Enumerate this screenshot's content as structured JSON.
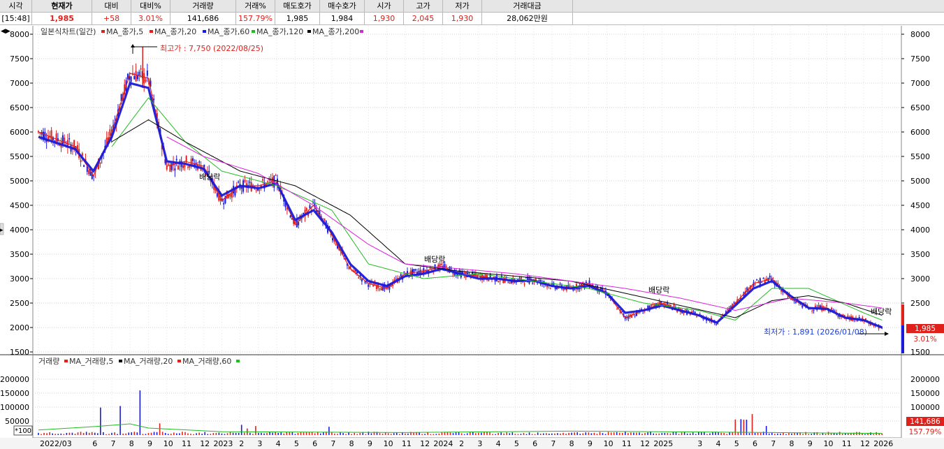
{
  "quote": {
    "headers": [
      "시각",
      "현재가",
      "대비",
      "대비%",
      "거래량",
      "거래%",
      "매도호가",
      "매수호가",
      "시가",
      "고가",
      "저가",
      "거래대금"
    ],
    "values": [
      "[15:48]",
      "1,985",
      "+58",
      "3.01%",
      "141,686",
      "157.79%",
      "1,985",
      "1,984",
      "1,930",
      "2,045",
      "1,930",
      "28,062만원"
    ]
  },
  "price_legend": {
    "title": "일본식차트(일간)",
    "items": [
      {
        "label": "MA_종가,5",
        "color": "#e0201b"
      },
      {
        "label": "MA_종가,20",
        "color": "#e0201b"
      },
      {
        "label": "MA_종가,60",
        "color": "#1b1bd8"
      },
      {
        "label": "MA_종가,120",
        "color": "#22bb22"
      },
      {
        "label": "MA_종가,200",
        "color": "#dd22dd"
      }
    ]
  },
  "volume_legend": {
    "title": "거래량",
    "items": [
      {
        "label": "MA_거래량,5",
        "color": "#e0201b"
      },
      {
        "label": "MA_거래량,20",
        "color": "#000000"
      },
      {
        "label": "MA_거래량,60",
        "color": "#22bb22"
      }
    ]
  },
  "annotations": {
    "high": "최고가 : 7,750 (2022/08/25)",
    "low": "최저가 : 1,891 (2026/01/08)",
    "dividend": "배당락"
  },
  "price_tag": {
    "price": "1,985",
    "change": "3.01%"
  },
  "volume_tag": {
    "volume": "141,686",
    "change": "157.79%"
  },
  "volume_unit": "*100",
  "chart_data": {
    "type": "line",
    "price_axis": {
      "ticks": [
        8000,
        7500,
        7000,
        6500,
        6000,
        5500,
        5000,
        4500,
        4000,
        3500,
        3000,
        2500,
        2000,
        1500
      ],
      "range": [
        1500,
        8000
      ]
    },
    "volume_axis": {
      "ticks": [
        200000,
        150000,
        100000,
        50000
      ],
      "range": [
        0,
        240000
      ]
    },
    "x_labels": [
      "2022/03",
      "6",
      "7",
      "8",
      "9",
      "10",
      "11",
      "12",
      "2023",
      "2",
      "3",
      "4",
      "5",
      "6",
      "7",
      "8",
      "9",
      "10",
      "11",
      "12",
      "2024",
      "2",
      "3",
      "4",
      "5",
      "6",
      "7",
      "8",
      "9",
      "10",
      "11",
      "12",
      "2025",
      "3",
      "4",
      "5",
      "6",
      "7",
      "8",
      "9",
      "10",
      "11",
      "12",
      "2026"
    ],
    "series": [
      {
        "name": "MA_종가,5",
        "color": "#e0201b",
        "x": [
          "2022/03",
          "2022/05",
          "2022/06",
          "2022/07",
          "2022/08",
          "2022/09",
          "2022/10",
          "2022/11",
          "2022/12",
          "2023/01",
          "2023/02",
          "2023/03",
          "2023/04",
          "2023/05",
          "2023/06",
          "2023/07",
          "2023/08",
          "2023/09",
          "2023/10",
          "2023/11",
          "2023/12",
          "2024/01",
          "2024/02",
          "2024/03",
          "2024/04",
          "2024/05",
          "2024/06",
          "2024/07",
          "2024/08",
          "2024/09",
          "2024/10",
          "2024/11",
          "2024/12",
          "2025/01",
          "2025/02",
          "2025/03",
          "2025/04",
          "2025/05",
          "2025/06",
          "2025/07",
          "2025/08",
          "2025/09",
          "2025/10",
          "2025/11",
          "2025/12",
          "2026/01"
        ],
        "values": [
          6000,
          5700,
          5100,
          6000,
          7200,
          7100,
          5300,
          5400,
          5300,
          4600,
          4900,
          4900,
          5000,
          4100,
          4500,
          3900,
          3200,
          2900,
          2800,
          3100,
          3150,
          3250,
          3100,
          3050,
          3000,
          2950,
          2980,
          2850,
          2800,
          2900,
          2700,
          2200,
          2350,
          2500,
          2350,
          2250,
          2100,
          2500,
          2900,
          3000,
          2600,
          2400,
          2400,
          2200,
          2150,
          1985
        ]
      },
      {
        "name": "MA_종가,60",
        "color": "#1b1bd8",
        "x": [
          "2022/03",
          "2022/05",
          "2022/06",
          "2022/07",
          "2022/08",
          "2022/09",
          "2022/10",
          "2022/11",
          "2022/12",
          "2023/01",
          "2023/02",
          "2023/03",
          "2023/04",
          "2023/05",
          "2023/06",
          "2023/07",
          "2023/08",
          "2023/09",
          "2023/10",
          "2023/11",
          "2023/12",
          "2024/01",
          "2024/02",
          "2024/03",
          "2024/04",
          "2024/05",
          "2024/06",
          "2024/07",
          "2024/08",
          "2024/09",
          "2024/10",
          "2024/11",
          "2024/12",
          "2025/01",
          "2025/02",
          "2025/03",
          "2025/04",
          "2025/05",
          "2025/06",
          "2025/07",
          "2025/08",
          "2025/09",
          "2025/10",
          "2025/11",
          "2025/12",
          "2026/01"
        ],
        "values": [
          5900,
          5650,
          5200,
          5900,
          7000,
          6900,
          5400,
          5350,
          5250,
          4700,
          4900,
          4850,
          4950,
          4200,
          4400,
          3950,
          3300,
          2950,
          2850,
          3050,
          3100,
          3200,
          3100,
          3000,
          3000,
          2950,
          2960,
          2850,
          2800,
          2850,
          2700,
          2300,
          2350,
          2450,
          2350,
          2250,
          2100,
          2450,
          2800,
          2950,
          2650,
          2400,
          2380,
          2200,
          2150,
          2000
        ]
      },
      {
        "name": "MA_종가,120",
        "color": "#22bb22",
        "x": [
          "2022/07",
          "2022/09",
          "2022/11",
          "2023/01",
          "2023/04",
          "2023/07",
          "2023/09",
          "2023/12",
          "2024/03",
          "2024/06",
          "2024/09",
          "2024/12",
          "2025/03",
          "2025/05",
          "2025/07",
          "2025/09",
          "2025/12",
          "2026/01"
        ],
        "values": [
          5700,
          6700,
          5800,
          5200,
          4900,
          4400,
          3300,
          3000,
          3100,
          2950,
          2800,
          2500,
          2350,
          2150,
          2800,
          2800,
          2300,
          2150
        ]
      },
      {
        "name": "MA_종가,200",
        "color": "#000000",
        "x": [
          "2022/07",
          "2022/09",
          "2022/11",
          "2023/02",
          "2023/05",
          "2023/08",
          "2023/11",
          "2024/02",
          "2024/05",
          "2024/08",
          "2024/11",
          "2025/02",
          "2025/05",
          "2025/07",
          "2025/09",
          "2025/11",
          "2026/01"
        ],
        "values": [
          5800,
          6250,
          5800,
          5200,
          4900,
          4300,
          3300,
          3150,
          3050,
          2950,
          2700,
          2450,
          2200,
          2550,
          2650,
          2500,
          2250
        ]
      },
      {
        "name": "MA_종가,200",
        "color": "#dd22dd",
        "x": [
          "2022/10",
          "2022/12",
          "2023/03",
          "2023/06",
          "2023/09",
          "2023/11",
          "2024/02",
          "2024/05",
          "2024/08",
          "2024/11",
          "2025/02",
          "2025/05",
          "2025/08",
          "2025/11",
          "2026/01"
        ],
        "values": [
          5900,
          5500,
          5150,
          4500,
          3700,
          3300,
          3200,
          3100,
          2950,
          2800,
          2600,
          2350,
          2600,
          2500,
          2400
        ]
      }
    ]
  }
}
